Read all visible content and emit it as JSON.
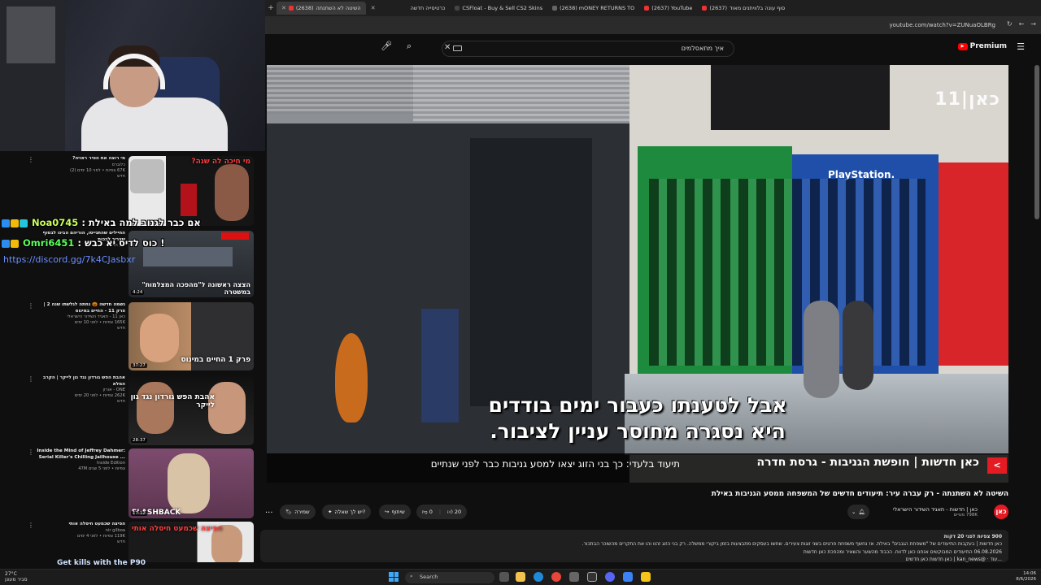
{
  "browser": {
    "tabs": [
      {
        "label": "השיטה לא השתנתה",
        "count": "(2638)",
        "active": true
      },
      {
        "label": "כרטיסייה חדשה",
        "active": false
      },
      {
        "label": "CSFloat - Buy & Sell CS2 Skins",
        "active": false
      },
      {
        "label": "(2638) mONEY RETURNS TO",
        "active": false
      },
      {
        "label": "(2637) YouTube",
        "active": false
      },
      {
        "label": "סוף עונה בלוויתנים מאוד",
        "count": "(2637)",
        "active": false
      }
    ],
    "url": "youtube.com/watch?v=ZUNuaOLBRg",
    "new_tab": "+"
  },
  "youtube": {
    "search_value": "איך מתאסלמים",
    "premium_label": "Premium",
    "premium_logo": "▶"
  },
  "chat": [
    {
      "user": "Noa0745",
      "text": " : אם כבר לגנוב למה באילת",
      "color": "#c9ff5a"
    },
    {
      "user": "Omri6451",
      "text": " : כוס לדיס יא כבש !",
      "color": "#5cff5c"
    }
  ],
  "chat_link": "https://discord.gg/7k4CJasbxr",
  "recommendations": [
    {
      "title": "מי רוצה את הטיר ראויה?",
      "channel": "כלוברס",
      "stats": "67K צפיות • לפני 10 ימים (2)",
      "badge": "חדש",
      "caption": "מי חיכה לה שנה?",
      "duration": ""
    },
    {
      "title": "החיילים שהתגייסו, הוריהם הבינו לבסוף שצריך לבכות",
      "channel": "כאן חדשות",
      "stats": "",
      "badge": "",
      "caption": "הצצה ראשונה ל\"מהפכה המצלמות\" במשטרה",
      "duration": "4:24"
    },
    {
      "title": "נשמה חדשה 🎃 נחתה לגלשתו שנה 2 | פרק 11 - החיים במינוס",
      "channel": "כאן 11 - תאגיד השידור הישראלי",
      "stats": "165K צפיות • לפני 10 ימים",
      "badge": "חדש",
      "caption": "פרק 1 החיים במינוס",
      "duration": "37:27"
    },
    {
      "title": "אהבת הפש גורדון נגד גון לייקר | הקרב המלא",
      "channel": "ONE - אורזן",
      "stats": "262K צפיות • לפני 20 ימים",
      "badge": "חדש",
      "caption": "אהבת הפש גורדון נגד גון לייקר",
      "duration": "28:37"
    },
    {
      "title": "Inside the Mind of Jeffrey Dahmer: Serial Killer's Chilling Jailhouse ...",
      "channel": "Inside Edition",
      "stats": "47M צפיות • לפני 5 שנים",
      "badge": "",
      "caption": "FLASHBACK",
      "duration": "17:12"
    },
    {
      "title": "הפיצה שכמעט חיסלה אותי",
      "channel": "nir gilboa",
      "stats": "119K צפיות • לפני 4 ימים",
      "badge": "חדש",
      "caption": "הפיצה שכמעט חיסלה אותי",
      "duration": ""
    }
  ],
  "player": {
    "logo": "כאן|11",
    "subtitle_line1": "אבל לטענתו כעבור ימים בודדים",
    "subtitle_line2": "היא נסגרה מחוסר עניין לציבור.",
    "news_main": "כאן חדשות  |  חופשת הגניבות - גרסת חדרה",
    "news_ticker": "תיעוד בלעדי: כך בני הזוג יצאו למסע גניבות כבר לפני שנתיים",
    "news_badge": "כאן",
    "news_arrow": "<"
  },
  "video": {
    "title": "השיטה לא השתנתה - רק עברה עיר: תיעודים חדשים של המשפחה ממסע הגניבות באילת",
    "channel_name": "כאן | חדשות - תאגיד השידור הישראלי",
    "subscribers": "798K מנויים",
    "channel_avatar": "כאן",
    "likes": "20",
    "dislikes": "0",
    "share": "שיתוף",
    "ask": "יש לך שאלה?",
    "save": "שמירה",
    "more": "..."
  },
  "description": {
    "line1": "900 צפיות  לפני 20 דקות",
    "line2": "כאן חדשות | בעקבות התיעודים של \"משפחת הגנבים\" באילת. אז נחשף משפחת פרטים בשני זוגות צעירים. שחשו בעסקים מתבצעות בזמן ביקורי ממשלה. רק בני הזוג זהוו והו את התקרים מהשוכר הבתכור.",
    "line3": "06.08.2026 התיעודים המבוקשים אנחנו כאן לדווח. הכבוד מהשער והשאיר ומהפכת כאן חדשות",
    "line4": "...עוד · @kan_news | כאן חדשות כאן חדשים"
  },
  "bottom_ticker": "Get kills with the P90",
  "taskbar": {
    "temp": "27°C",
    "weather": "סביר מעונן",
    "search": "Search",
    "time": "14:06",
    "date": "8/6/2026"
  },
  "colors": {
    "youtube_red": "#ff0000",
    "kan_red": "#e41b23",
    "chat_link": "#6c8eff"
  }
}
